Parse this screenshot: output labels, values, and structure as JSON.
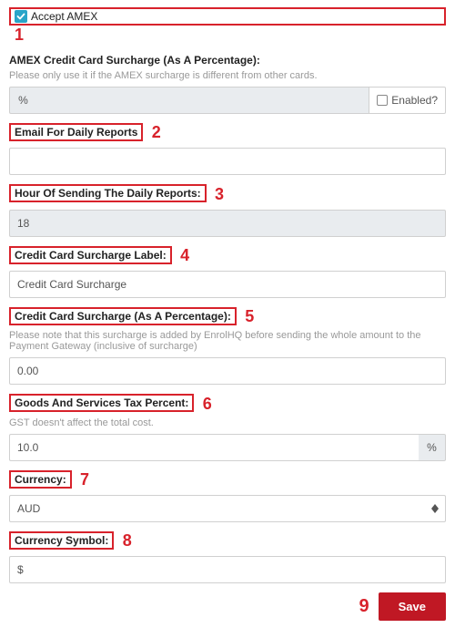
{
  "accept_amex": {
    "label": "Accept AMEX",
    "checked": true,
    "annot": "1"
  },
  "amex_surcharge": {
    "heading": "AMEX Credit Card Surcharge (As A Percentage):",
    "helper": "Please only use it if the AMEX surcharge is different from other cards.",
    "prefix": "%",
    "enabled_label": "Enabled?",
    "value": ""
  },
  "email_reports": {
    "label": "Email For Daily Reports",
    "annot": "2",
    "value": ""
  },
  "hour_reports": {
    "label": "Hour Of Sending The Daily Reports:",
    "annot": "3",
    "value": "18"
  },
  "cc_label": {
    "label": "Credit Card Surcharge Label:",
    "annot": "4",
    "value": "Credit Card Surcharge"
  },
  "cc_pct": {
    "label": "Credit Card Surcharge (As A Percentage):",
    "annot": "5",
    "helper": "Please note that this surcharge is added by EnrolHQ before sending the whole amount to the Payment Gateway (inclusive of surcharge)",
    "value": "0.00"
  },
  "gst": {
    "label": "Goods And Services Tax Percent:",
    "annot": "6",
    "helper": "GST doesn't affect the total cost.",
    "value": "10.0",
    "suffix": "%"
  },
  "currency": {
    "label": "Currency:",
    "annot": "7",
    "value": "AUD"
  },
  "currency_symbol": {
    "label": "Currency Symbol:",
    "annot": "8",
    "value": "$"
  },
  "save": {
    "label": "Save",
    "annot": "9"
  }
}
